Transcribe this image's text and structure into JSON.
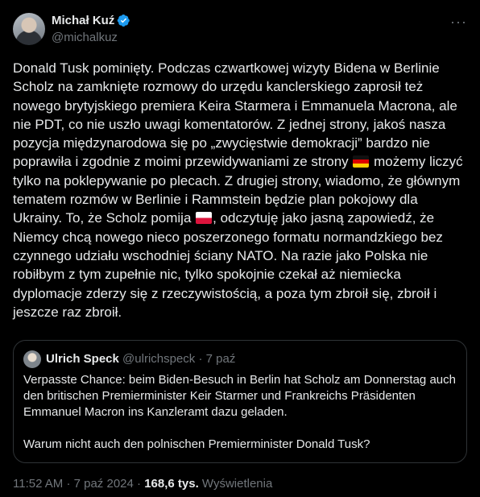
{
  "author": {
    "name": "Michał Kuź",
    "handle": "@michalkuz"
  },
  "tweet": {
    "segments": [
      "Donald Tusk pominięty. Podczas czwartkowej wizyty Bidena w Berlinie Scholz na zamknięte rozmowy do urzędu kanclerskiego zaprosił też nowego brytyjskiego premiera Keira Starmera i Emmanuela Macrona, ale nie PDT, co nie uszło uwagi komentatorów. Z jednej strony, jakoś nasza pozycja międzynarodowa się po „zwycięstwie demokracji” bardzo nie poprawiła i zgodnie z moimi przewidywaniami ze strony ",
      " możemy liczyć tylko na poklepywanie po plecach. Z drugiej strony, wiadomo, że głównym tematem rozmów w Berlinie i Rammstein będzie plan pokojowy dla Ukrainy. To, że Scholz pomija ",
      ", odczytuję jako jasną zapowiedź, że Niemcy chcą nowego nieco poszerzonego formatu normandzkiego bez czynnego udziału wschodniej ściany NATO. Na razie jako Polska nie robiłbym z tym zupełnie nic, tylko spokojnie czekał aż niemiecka dyplomacje zderzy się z rzeczywistością, a poza tym zbroił się, zbroił i jeszcze raz zbroił."
    ],
    "flag_1": "germany-flag-icon",
    "flag_2": "poland-flag-icon"
  },
  "quote": {
    "name": "Ulrich Speck",
    "handle": "@ulrichspeck",
    "separator": "·",
    "date": "7 paź",
    "paragraph_1": "Verpasste Chance: beim Biden-Besuch in Berlin hat Scholz am Donnerstag auch den britischen Premierminister Keir Starmer und Frankreichs Präsidenten Emmanuel Macron ins Kanzleramt dazu geladen.",
    "paragraph_2": "Warum nicht auch den polnischen Premierminister Donald Tusk?"
  },
  "meta": {
    "time": "11:52 AM",
    "separator": "·",
    "date": "7 paź 2024",
    "views_count": "168,6 tys.",
    "views_label": "Wyświetlenia"
  },
  "colors": {
    "background": "#000000",
    "text": "#e7e9ea",
    "muted": "#71767b",
    "verified": "#1d9bf0",
    "border": "#2f3336"
  }
}
